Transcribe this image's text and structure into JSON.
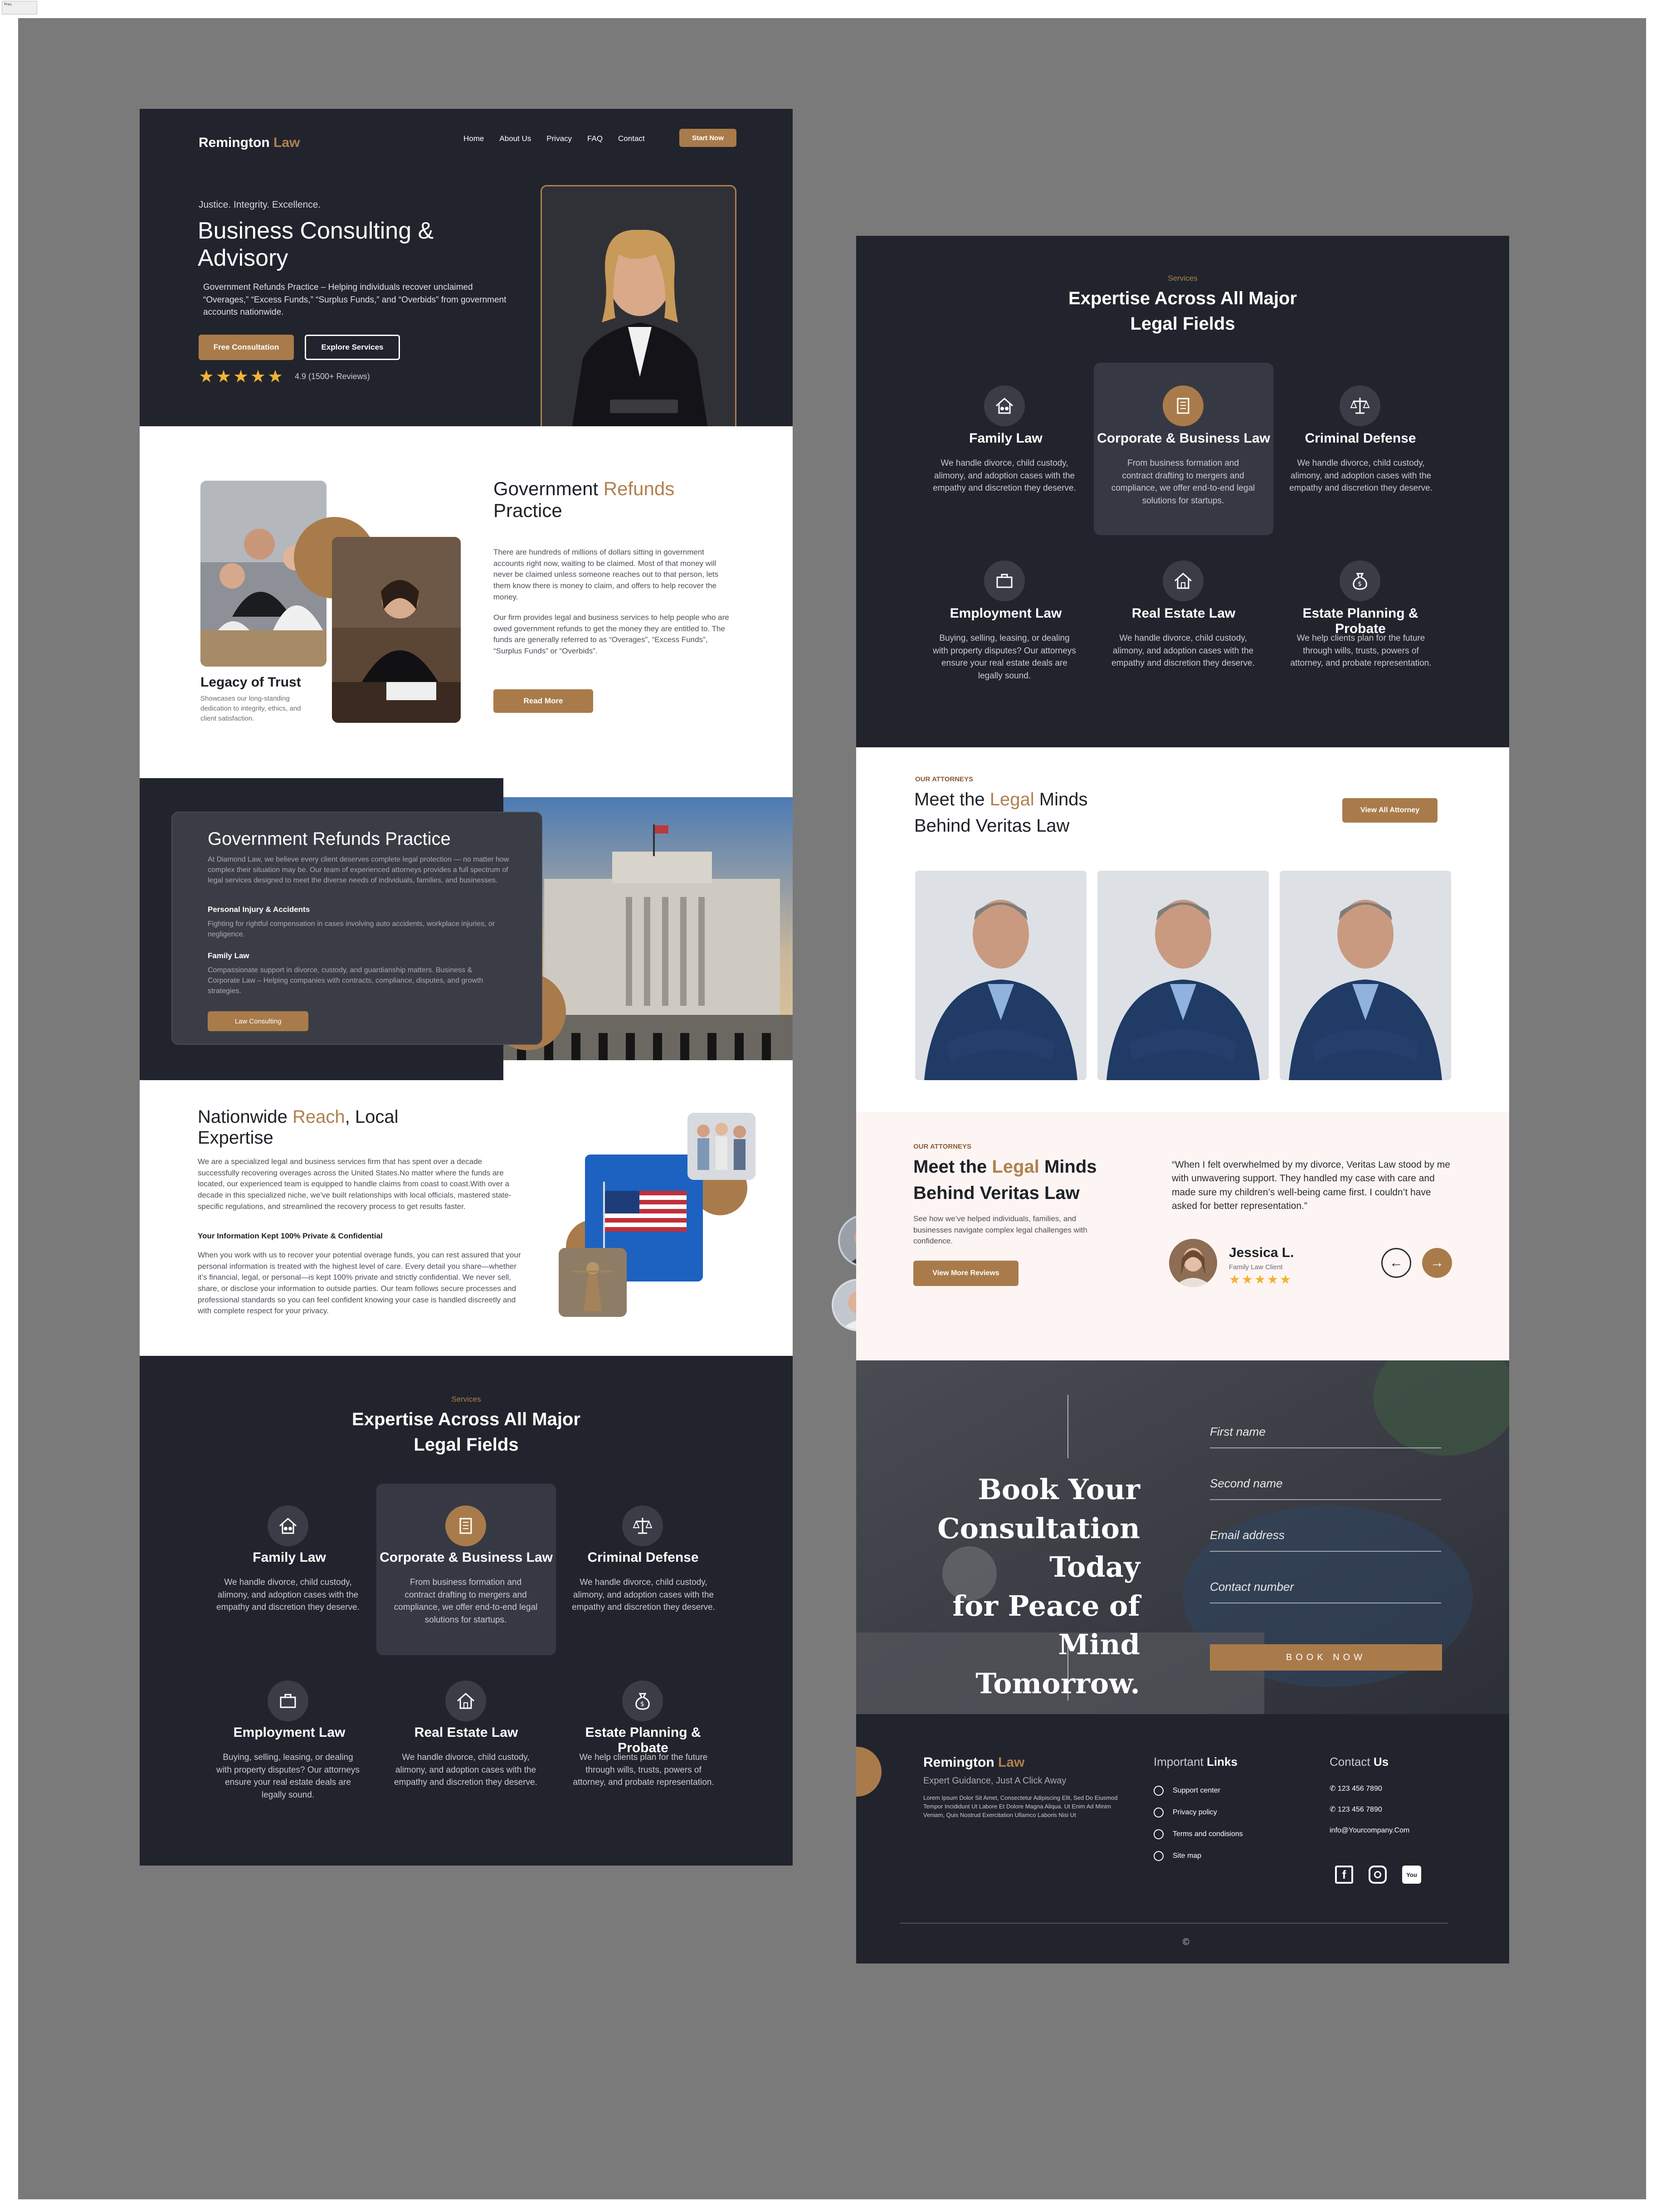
{
  "artboard_tag": "Pres",
  "brand": {
    "name_first": "Remington",
    "name_second": "Law",
    "accent": "#a97b4b",
    "dark": "#21242c"
  },
  "nav": {
    "items": [
      "Home",
      "About Us",
      "Privacy",
      "FAQ",
      "Contact"
    ],
    "cta": "Start Now"
  },
  "hero": {
    "tagline": "Justice. Integrity. Excellence.",
    "title_line1": "Business Consulting &",
    "title_line2": "Advisory",
    "description": "Government Refunds Practice – Helping individuals recover unclaimed “Overages,” “Excess Funds,” “Surplus Funds,” and “Overbids” from government accounts nationwide.",
    "primary_cta": "Free Consultation",
    "secondary_cta": "Explore Services",
    "rating": "4.9 (1500+ Reviews)",
    "stars": 5
  },
  "practice": {
    "title_plain": "Government",
    "title_accent": "Refunds",
    "title_line2": "Practice",
    "para1": "There are hundreds of millions of dollars sitting in government accounts right now, waiting to be claimed. Most of that money will never be claimed unless someone reaches out to that person, lets them know there is money to claim, and offers to help recover the money.",
    "para2": "Our firm provides legal and business services to help people who are owed government refunds to get the money they are entitled to.  The funds are generally referred to as “Overages”, “Excess Funds”, “Surplus Funds” or “Overbids”.",
    "cta": "Read More",
    "legacy_title": "Legacy of Trust",
    "legacy_text": "Showcases our long-standing dedication to integrity, ethics, and client satisfaction."
  },
  "refunds_card": {
    "title": "Government Refunds Practice",
    "intro": "At Diamond Law, we believe every client deserves complete legal protection — no matter how complex their situation may be. Our team of experienced attorneys provides a full spectrum of legal services designed to meet the diverse needs of individuals, families, and businesses.",
    "h1": "Personal Injury & Accidents",
    "p1": "Fighting for rightful compensation in cases involving auto accidents, workplace injuries, or negligence.",
    "h2": "Family Law",
    "p2": "Compassionate support in divorce, custody, and guardianship matters. Business & Corporate Law – Helping companies with contracts, compliance, disputes, and growth strategies.",
    "cta": "Law Consulting"
  },
  "reach": {
    "title_plain": "Nationwide",
    "title_accent": "Reach",
    "title_rest": ", Local",
    "title_line2": "Expertise",
    "para1": "We are a specialized legal and business services firm that has spent over a decade successfully recovering overages across the United States.No matter where the funds are located, our experienced team is equipped to handle claims from coast to coast.With over a decade in this specialized niche, we’ve built relationships with local officials, mastered state-specific regulations, and streamlined the recovery process to get results faster.",
    "subhead": "Your Information Kept 100% Private & Confidential",
    "para2": "When you work with us to recover your potential overage funds, you can rest assured that your personal information is treated with the highest level of care. Every detail you share—whether it’s financial, legal, or personal—is kept 100% private and strictly confidential. We never sell, share, or disclose your information to outside parties. Our team follows secure processes and professional standards so you can feel confident knowing your case is handled discreetly and with complete respect for your privacy."
  },
  "services": {
    "eyebrow": "Services",
    "title_line1": "Expertise Across All Major",
    "title_line2": "Legal Fields",
    "items": [
      {
        "title": "Family Law",
        "desc": "We handle divorce, child custody, alimony, and adoption cases with the empathy and discretion they deserve.",
        "icon": "family-house-icon"
      },
      {
        "title": "Corporate & Business Law",
        "desc": "From business formation and contract drafting to mergers and compliance, we offer end-to-end legal solutions for startups.",
        "icon": "building-icon"
      },
      {
        "title": "Criminal Defense",
        "desc": "We handle divorce, child custody, alimony, and adoption cases with the empathy and discretion they deserve.",
        "icon": "scales-icon"
      },
      {
        "title": "Employment Law",
        "desc": "Buying, selling, leasing, or dealing with property disputes? Our attorneys ensure your real estate deals are legally sound.",
        "icon": "briefcase-icon"
      },
      {
        "title": "Real Estate Law",
        "desc": "We handle divorce, child custody, alimony, and adoption cases with the empathy and discretion they deserve.",
        "icon": "home-icon"
      },
      {
        "title": "Estate Planning & Probate",
        "desc": "We help clients plan for the future through wills, trusts, powers of attorney, and probate representation.",
        "icon": "money-bag-icon"
      }
    ]
  },
  "attorneys": {
    "eyebrow": "OUR ATTORNEYS",
    "title_plain": "Meet the",
    "title_accent": "Legal",
    "title_rest": "Minds",
    "title_line2": "Behind Veritas Law",
    "cta": "View All Attorney"
  },
  "testimonials": {
    "eyebrow": "OUR ATTORNEYS",
    "title_plain": "Meet the",
    "title_accent": "Legal",
    "title_rest": "Minds",
    "title_line2": "Behind Veritas Law",
    "description": "See how we’ve helped individuals, families, and businesses navigate complex legal challenges with confidence.",
    "cta": "View More Reviews",
    "quote": "“When I felt overwhelmed by my divorce, Veritas Law stood by me with unwavering support. They handled my case with care and made sure my children’s well-being came first. I couldn’t have asked for better representation.”",
    "reviewer_name": "Jessica L.",
    "reviewer_role": "Family Law Client",
    "stars": 5
  },
  "booking": {
    "title_lines": [
      "Book Your",
      "Consultation Today",
      "for Peace of Mind",
      "Tomorrow."
    ],
    "fields": [
      "First name",
      "Second name",
      "Email address",
      "Contact number"
    ],
    "cta": "BOOK NOW"
  },
  "footer": {
    "tagline": "Expert Guidance, Just A Click Away",
    "lorem": "Lorem Ipsum Dolor Sit Amet, Consectetur Adipiscing Elit, Sed Do Eiusmod Tempor Incididunt Ut Labore Et Dolore Magna Aliqua. Ut Enim Ad Minim Veniam, Quis Nostrud Exercitation Ullamco Laboris Nisi Ut",
    "links_title_plain": "Important",
    "links_title_bold": "Links",
    "links": [
      "Support center",
      "Privacy policy",
      "Terms and condisions",
      "Site map"
    ],
    "contact_title_plain": "Contact",
    "contact_title_bold": "Us",
    "phones": [
      "123 456 7890",
      "123 456 7890"
    ],
    "email": "info@Yourcompany.Com",
    "copyright": "©"
  }
}
